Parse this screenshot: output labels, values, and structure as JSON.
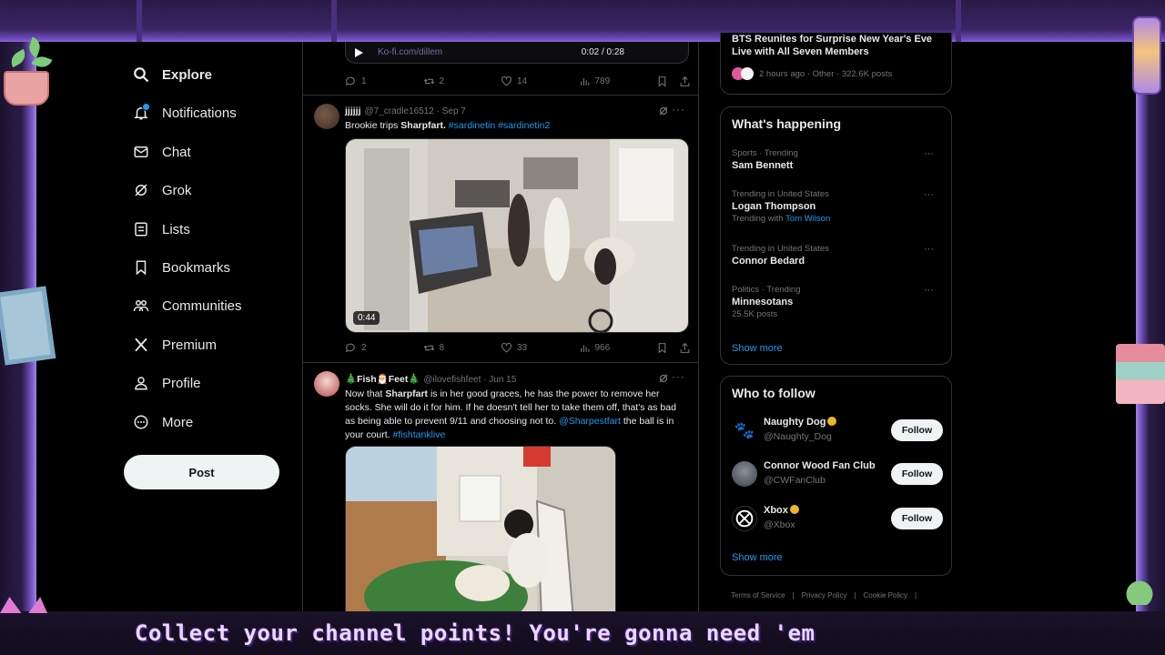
{
  "nav": {
    "items": [
      {
        "label": "Explore",
        "icon": "search-icon"
      },
      {
        "label": "Notifications",
        "icon": "bell-icon"
      },
      {
        "label": "Chat",
        "icon": "envelope-icon"
      },
      {
        "label": "Grok",
        "icon": "grok-icon"
      },
      {
        "label": "Lists",
        "icon": "list-icon"
      },
      {
        "label": "Bookmarks",
        "icon": "bookmark-icon"
      },
      {
        "label": "Communities",
        "icon": "communities-icon"
      },
      {
        "label": "Premium",
        "icon": "x-logo-icon"
      },
      {
        "label": "Profile",
        "icon": "person-icon"
      },
      {
        "label": "More",
        "icon": "more-circle-icon"
      }
    ],
    "post_label": "Post"
  },
  "feed": {
    "player": {
      "kofi": "Ko-fi.com/dillem",
      "time": "0:02 / 0:28"
    },
    "top_actions": {
      "replies": "1",
      "reposts": "2",
      "likes": "14",
      "views": "789"
    },
    "tweet1": {
      "name": "jjjjjj",
      "handle": "@7_cradle16512",
      "date": "· Sep 7",
      "text_prefix": "Brookie trips ",
      "mention_bold": "Sharpfart.",
      "hashtags": " #sardinetin #sardinetin2",
      "duration": "0:44",
      "actions": {
        "replies": "2",
        "reposts": "8",
        "likes": "33",
        "views": "966"
      }
    },
    "tweet2": {
      "name": "🎄Fish🎅Feet🎄",
      "handle": "@ilovefishfeet",
      "date": "· Jun 15",
      "text_a": "Now that ",
      "bold_a": "Sharpfart",
      "text_b": " is in her good graces, he has the power to remove her socks. She will do it for him. If he doesn't tell her to take them off, that's as bad as being able to prevent 9/11 and choosing not to. ",
      "mention": "@Sharpestfart",
      "text_c": " the ball is in your court. ",
      "hashtag": "#fishtanklive"
    }
  },
  "right": {
    "top_news": {
      "title": "BTS Reunites for Surprise New Year's Eve Live with All Seven Members",
      "meta": "2 hours ago · Other · 322.6K posts"
    },
    "happening": {
      "title": "What's happening",
      "trends": [
        {
          "meta": "Sports · Trending",
          "name": "Sam Bennett",
          "sub": ""
        },
        {
          "meta": "Trending in United States",
          "name": "Logan Thompson",
          "sub": "Trending with ",
          "sub_link": "Tom Wilson"
        },
        {
          "meta": "Trending in United States",
          "name": "Connor Bedard",
          "sub": ""
        },
        {
          "meta": "Politics · Trending",
          "name": "Minnesotans",
          "sub": "25.5K posts"
        }
      ],
      "show_more": "Show more"
    },
    "who_to_follow": {
      "title": "Who to follow",
      "accounts": [
        {
          "name": "Naughty Dog",
          "handle": "@Naughty_Dog",
          "follow": "Follow"
        },
        {
          "name": "Connor Wood Fan Club",
          "handle": "@CWFanClub",
          "follow": "Follow"
        },
        {
          "name": "Xbox",
          "handle": "@Xbox",
          "follow": "Follow"
        }
      ],
      "show_more": "Show more"
    },
    "footer": [
      "Terms of Service",
      "|",
      "Privacy Policy",
      "|",
      "Cookie Policy",
      "|"
    ]
  },
  "overlay": {
    "caption": "Collect your channel points! You're gonna need 'em"
  },
  "colors": {
    "accent": "#1d9bf0",
    "frame_purple": "#8a64d6",
    "caption": "#e9d8ff"
  }
}
